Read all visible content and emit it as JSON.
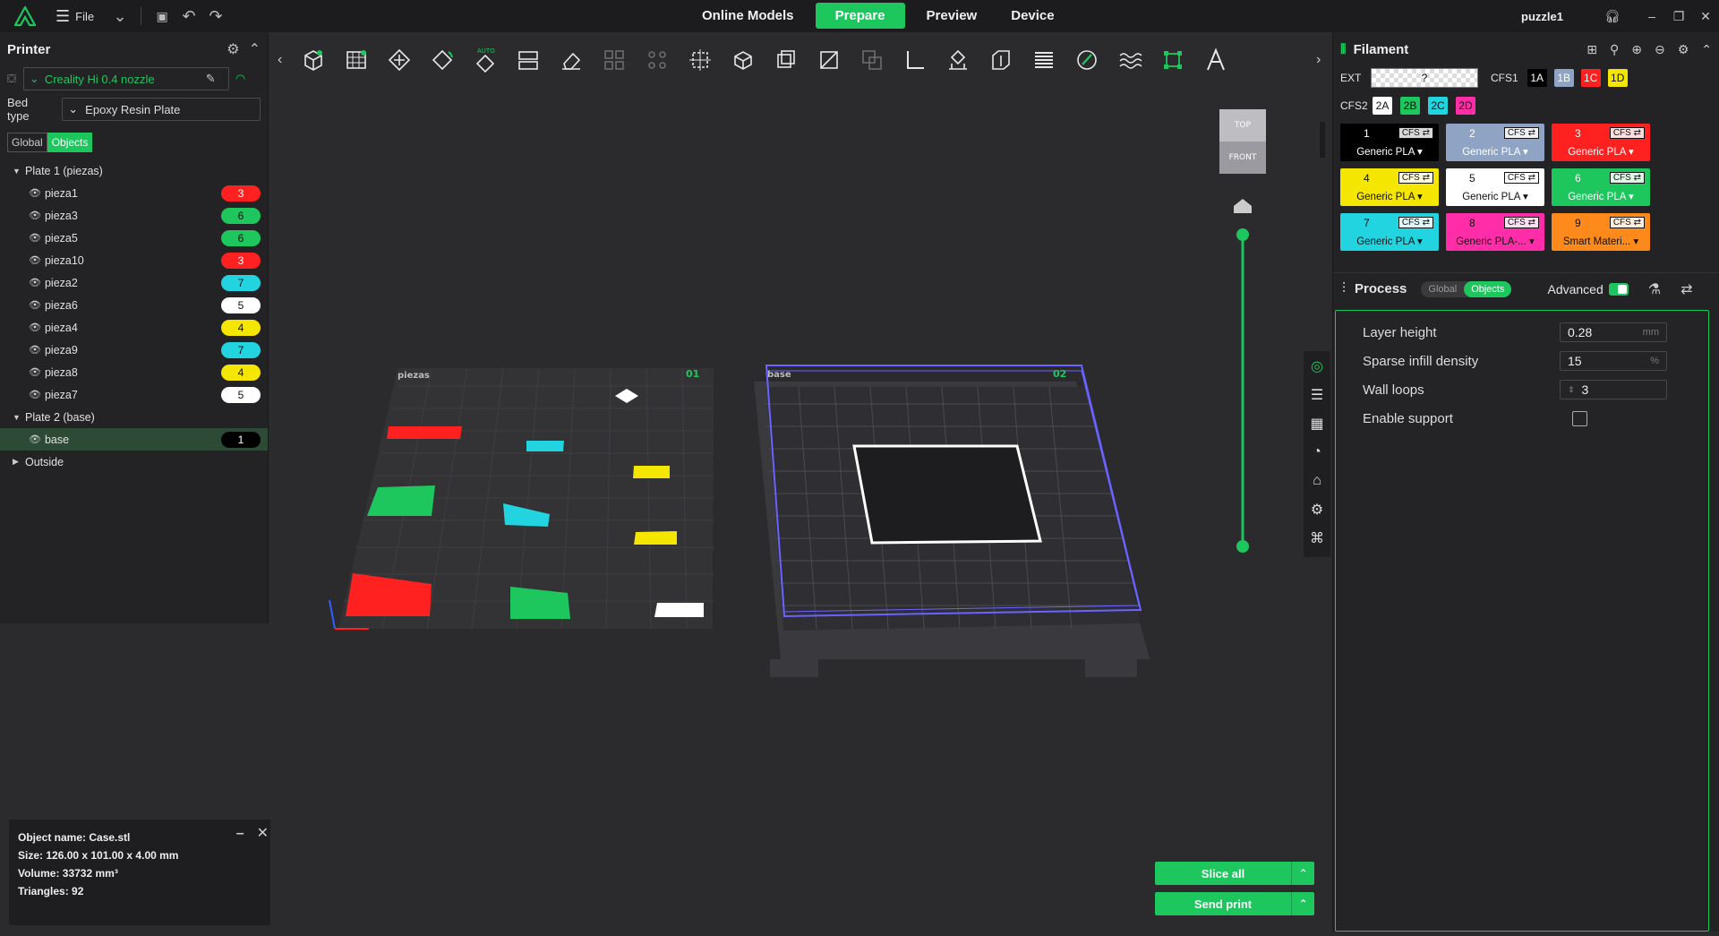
{
  "topbar": {
    "file_label": "File",
    "tabs": [
      "Online Models",
      "Prepare",
      "Preview",
      "Device"
    ],
    "active_tab": "Prepare",
    "user": "puzzle1",
    "accent": "#1ec65e"
  },
  "printer": {
    "title": "Printer",
    "printer_name": "Creality Hi 0.4 nozzle",
    "bed_label": "Bed type",
    "bed_value": "Epoxy Resin Plate",
    "toggle": [
      "Global",
      "Objects"
    ]
  },
  "tree": {
    "plate1": "Plate 1 (piezas)",
    "plate2": "Plate 2 (base)",
    "outside": "Outside",
    "plate1_items": [
      {
        "name": "pieza1",
        "slot": "3",
        "color": "#ff2020"
      },
      {
        "name": "pieza3",
        "slot": "6",
        "color": "#1ec65e"
      },
      {
        "name": "pieza5",
        "slot": "6",
        "color": "#1ec65e"
      },
      {
        "name": "pieza10",
        "slot": "3",
        "color": "#ff2020"
      },
      {
        "name": "pieza2",
        "slot": "7",
        "color": "#22d3e0"
      },
      {
        "name": "pieza6",
        "slot": "5",
        "color": "#ffffff"
      },
      {
        "name": "pieza4",
        "slot": "4",
        "color": "#f5e600"
      },
      {
        "name": "pieza9",
        "slot": "7",
        "color": "#22d3e0"
      },
      {
        "name": "pieza8",
        "slot": "4",
        "color": "#f5e600"
      },
      {
        "name": "pieza7",
        "slot": "5",
        "color": "#ffffff"
      }
    ],
    "plate2_items": [
      {
        "name": "base",
        "slot": "1",
        "color": "#000000"
      }
    ]
  },
  "object_info": {
    "name": "Object name: Case.stl",
    "size": "Size: 126.00 x 101.00 x 4.00 mm",
    "volume": "Volume: 33732 mm³",
    "triangles": "Triangles: 92"
  },
  "viewport": {
    "plate1_label": "piezas",
    "plate1_num": "01",
    "plate2_label": "base",
    "plate2_num": "02",
    "cube_top": "TOP",
    "cube_front": "FRONT"
  },
  "filament": {
    "title": "Filament",
    "ext_label": "EXT",
    "ext_value": "?",
    "cfs1_label": "CFS1",
    "cfs1": [
      {
        "id": "1A",
        "color": "#000000",
        "text": "#ffffff"
      },
      {
        "id": "1B",
        "color": "#8fa3c4",
        "text": "#ffffff"
      },
      {
        "id": "1C",
        "color": "#ff2020",
        "text": "#ffffff"
      },
      {
        "id": "1D",
        "color": "#f5e600",
        "text": "#111111"
      }
    ],
    "cfs2_label": "CFS2",
    "cfs2": [
      {
        "id": "2A",
        "color": "#ffffff",
        "text": "#111111"
      },
      {
        "id": "2B",
        "color": "#1ec65e",
        "text": "#111111"
      },
      {
        "id": "2C",
        "color": "#22d3e0",
        "text": "#111111"
      },
      {
        "id": "2D",
        "color": "#ff2ea8",
        "text": "#111111"
      }
    ],
    "slots": [
      {
        "num": "1",
        "cfs": "CFS ⇄",
        "mat": "Generic PLA ▾",
        "color": "#000000",
        "text": "#ffffff"
      },
      {
        "num": "2",
        "cfs": "CFS ⇄",
        "mat": "Generic PLA ▾",
        "color": "#8fa3c4",
        "text": "#ffffff"
      },
      {
        "num": "3",
        "cfs": "CFS ⇄",
        "mat": "Generic PLA ▾",
        "color": "#ff2020",
        "text": "#ffffff"
      },
      {
        "num": "4",
        "cfs": "CFS ⇄",
        "mat": "Generic PLA ▾",
        "color": "#f5e600",
        "text": "#111111"
      },
      {
        "num": "5",
        "cfs": "CFS ⇄",
        "mat": "Generic PLA ▾",
        "color": "#ffffff",
        "text": "#111111"
      },
      {
        "num": "6",
        "cfs": "CFS ⇄",
        "mat": "Generic PLA ▾",
        "color": "#1ec65e",
        "text": "#ffffff"
      },
      {
        "num": "7",
        "cfs": "CFS ⇄",
        "mat": "Generic PLA ▾",
        "color": "#22d3e0",
        "text": "#111111"
      },
      {
        "num": "8",
        "cfs": "CFS ⇄",
        "mat": "Generic PLA-... ▾",
        "color": "#ff2ea8",
        "text": "#111111"
      },
      {
        "num": "9",
        "cfs": "CFS ⇄",
        "mat": "Smart Materi... ▾",
        "color": "#ff8a1c",
        "text": "#111111"
      }
    ]
  },
  "process": {
    "title": "Process",
    "toggle": [
      "Global",
      "Objects"
    ],
    "advanced_label": "Advanced",
    "layer_height_label": "Layer height",
    "layer_height": "0.28",
    "layer_height_unit": "mm",
    "infill_label": "Sparse infill density",
    "infill": "15",
    "infill_unit": "%",
    "wall_loops_label": "Wall loops",
    "wall_loops": "3",
    "support_label": "Enable support"
  },
  "actions": {
    "slice_all": "Slice all",
    "send_print": "Send print"
  }
}
